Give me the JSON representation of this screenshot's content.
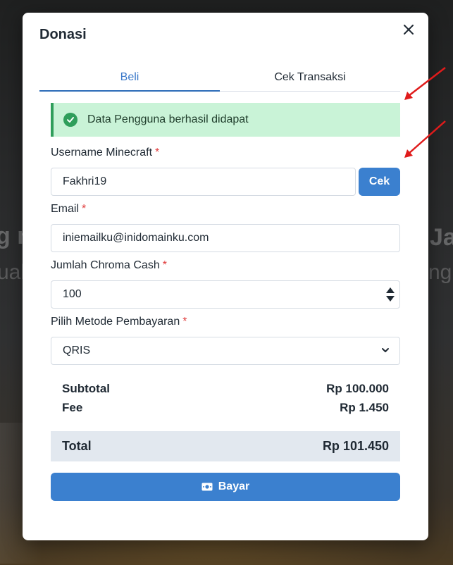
{
  "background": {
    "left_line_1": "g n",
    "left_line_2": "ual",
    "right_line_1": "Ja",
    "right_line_2": "ng"
  },
  "modal": {
    "title": "Donasi",
    "close_icon": "close-icon"
  },
  "tabs": [
    {
      "label": "Beli",
      "active": true
    },
    {
      "label": "Cek Transaksi",
      "active": false
    }
  ],
  "alert": {
    "icon": "check-circle-icon",
    "text": "Data Pengguna berhasil didapat",
    "color": "#2f9e5b"
  },
  "form": {
    "required_mark": "*",
    "username": {
      "label": "Username Minecraft",
      "value": "Fakhri19"
    },
    "cek_button": "Cek",
    "email": {
      "label": "Email",
      "value": "iniemailku@inidomainku.com"
    },
    "amount": {
      "label": "Jumlah Chroma Cash",
      "value": "100"
    },
    "payment": {
      "label": "Pilih Metode Pembayaran",
      "selected": "QRIS"
    }
  },
  "summary": {
    "subtotal_label": "Subtotal",
    "subtotal_value": "Rp 100.000",
    "fee_label": "Fee",
    "fee_value": "Rp 1.450",
    "total_label": "Total",
    "total_value": "Rp 101.450"
  },
  "pay_button": {
    "label": "Bayar",
    "icon": "money-icon"
  },
  "colors": {
    "accent": "#3b80cf",
    "required": "#e03a3a",
    "annotation_arrow": "#e01b1b"
  }
}
